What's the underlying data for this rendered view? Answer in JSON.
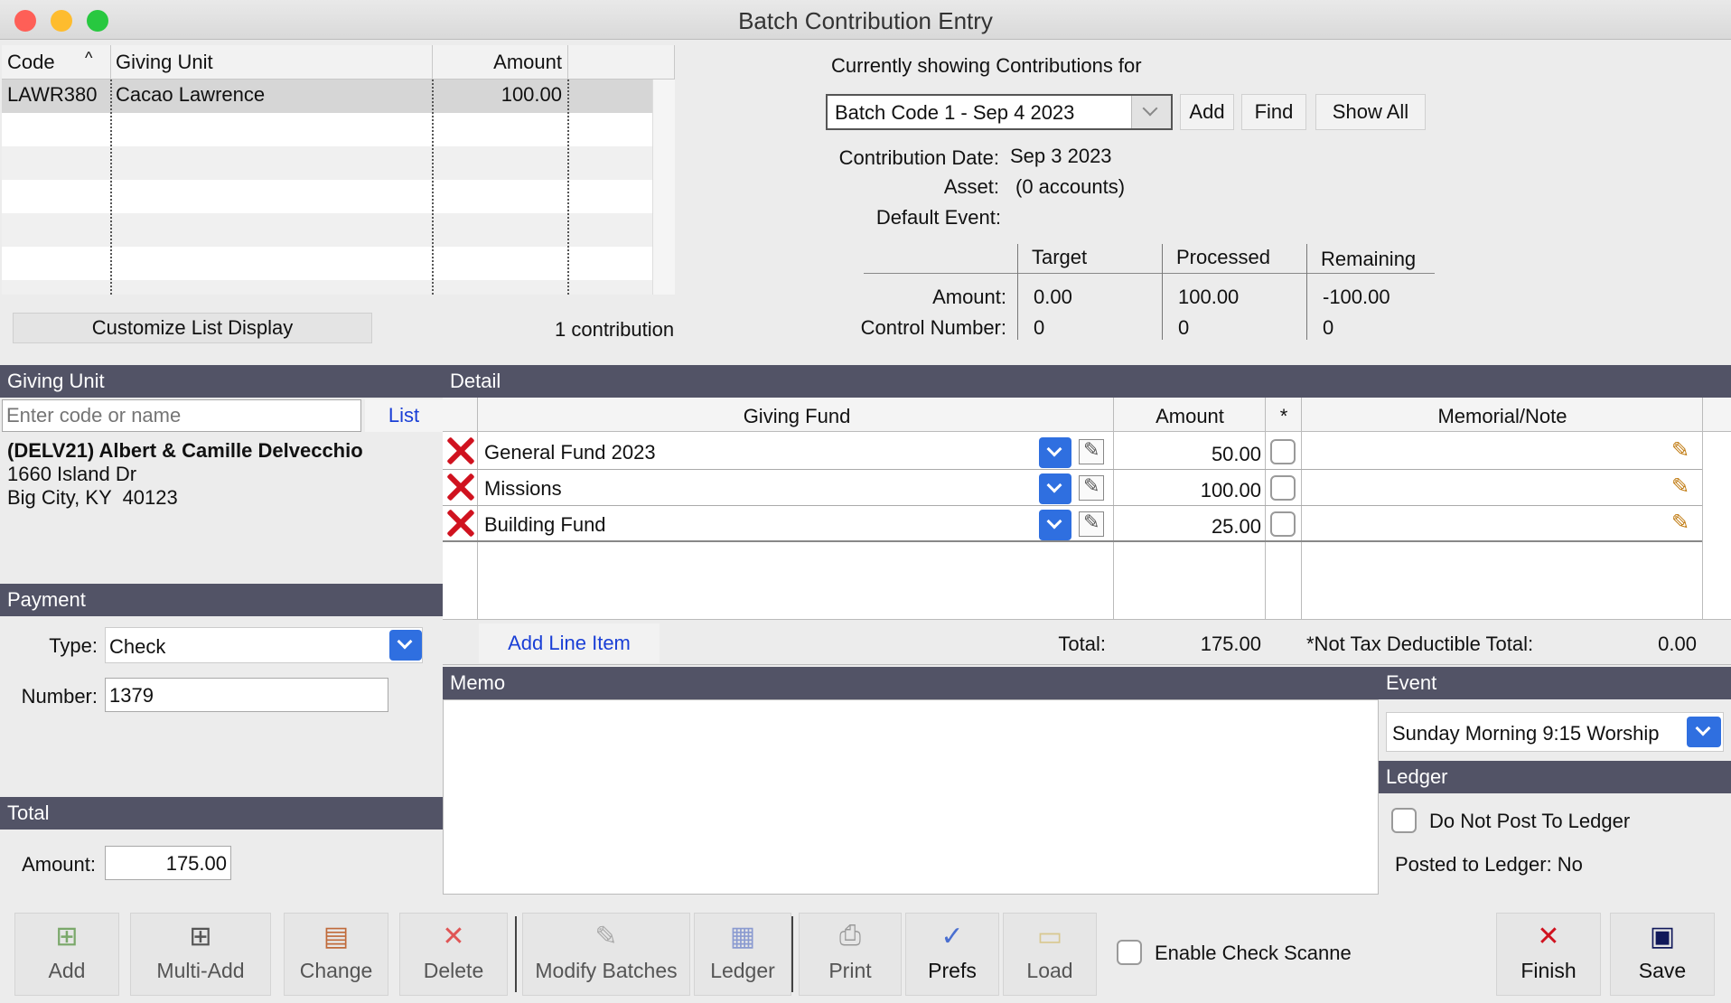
{
  "window": {
    "title": "Batch Contribution Entry"
  },
  "contributions_list": {
    "columns": {
      "code": "Code",
      "giving_unit": "Giving Unit",
      "amount": "Amount"
    },
    "rows": [
      {
        "code": "LAWR380",
        "giving_unit": "Cacao Lawrence",
        "amount": "100.00"
      }
    ],
    "customize_label": "Customize List Display",
    "count_label": "1 contribution"
  },
  "batch_info": {
    "showing_label": "Currently showing Contributions for",
    "batch_selected": "Batch Code 1 - Sep 4 2023",
    "add_label": "Add",
    "find_label": "Find",
    "show_all_label": "Show All",
    "contribution_date_label": "Contribution Date:",
    "contribution_date": "Sep 3 2023",
    "asset_label": "Asset:",
    "asset": "(0 accounts)",
    "default_event_label": "Default Event:",
    "col_target": "Target",
    "col_processed": "Processed",
    "col_remaining": "Remaining",
    "amount_label": "Amount:",
    "control_label": "Control Number:",
    "amount_target": "0.00",
    "amount_processed": "100.00",
    "amount_remaining": "-100.00",
    "control_target": "0",
    "control_processed": "0",
    "control_remaining": "0"
  },
  "giving_unit": {
    "header": "Giving Unit",
    "search_placeholder": "Enter code or name",
    "list_label": "List",
    "name": "(DELV21) Albert & Camille Delvecchio",
    "address1": "1660 Island Dr",
    "address2": "Big City, KY  40123"
  },
  "payment": {
    "header": "Payment",
    "type_label": "Type:",
    "type_value": "Check",
    "number_label": "Number:",
    "number_value": "1379"
  },
  "total": {
    "header": "Total",
    "amount_label": "Amount:",
    "amount_value": "175.00"
  },
  "detail": {
    "header": "Detail",
    "col_fund": "Giving Fund",
    "col_amount": "Amount",
    "col_star": "*",
    "col_note": "Memorial/Note",
    "lines": [
      {
        "fund": "General Fund 2023",
        "amount": "50.00"
      },
      {
        "fund": "Missions",
        "amount": "100.00"
      },
      {
        "fund": "Building Fund",
        "amount": "25.00"
      }
    ],
    "add_line_label": "Add Line Item",
    "total_label": "Total:",
    "total_value": "175.00",
    "not_tax_label": "*Not Tax Deductible Total:",
    "not_tax_value": "0.00"
  },
  "memo": {
    "header": "Memo"
  },
  "event": {
    "header": "Event",
    "selected": "Sunday Morning 9:15 Worship"
  },
  "ledger": {
    "header": "Ledger",
    "do_not_post_label": "Do Not Post To Ledger",
    "posted_label": "Posted to Ledger: No"
  },
  "toolbar": {
    "add": "Add",
    "multi_add": "Multi-Add",
    "change": "Change",
    "delete": "Delete",
    "modify_batches": "Modify Batches",
    "ledger": "Ledger",
    "print": "Print",
    "prefs": "Prefs",
    "load": "Load",
    "enable_check_scanner": "Enable Check Scanne",
    "finish": "Finish",
    "save": "Save"
  },
  "colors": {
    "section_bar": "#525366",
    "link": "#1a3fd6",
    "delete_red": "#d0121f",
    "select_blue": "#2f6fe0"
  }
}
